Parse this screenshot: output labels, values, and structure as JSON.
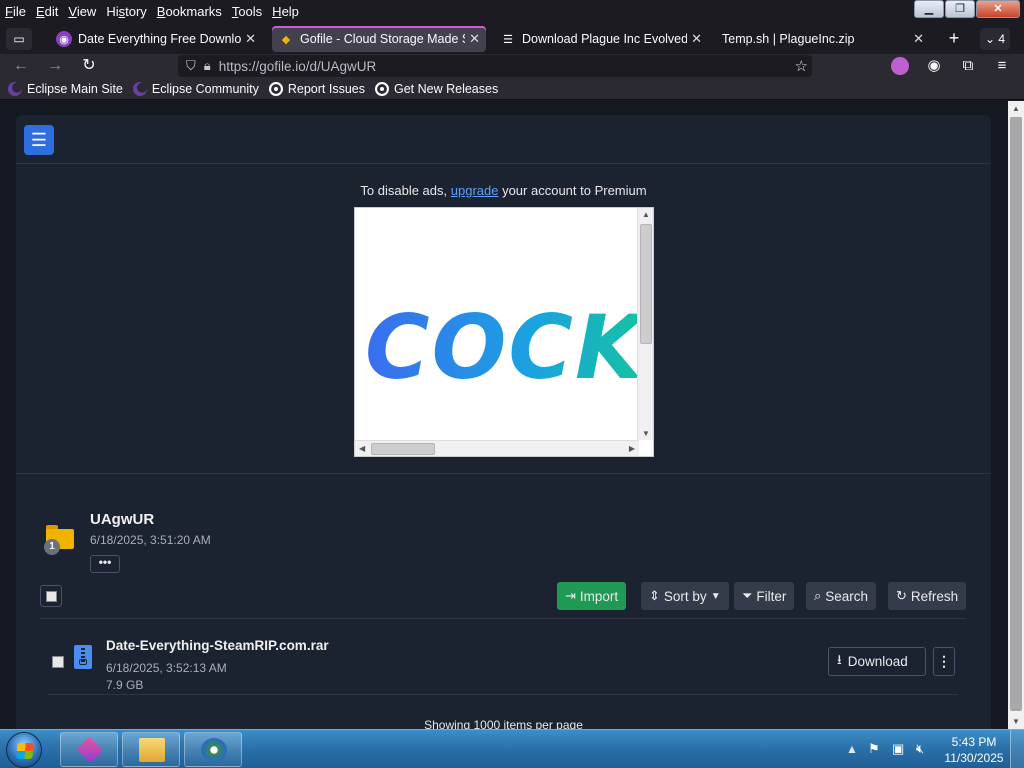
{
  "menubar": {
    "items": [
      {
        "key": "F",
        "rest": "ile"
      },
      {
        "key": "E",
        "rest": "dit"
      },
      {
        "key": "V",
        "rest": "iew"
      },
      {
        "key": "",
        "pre": "Hi",
        "keymid": "s",
        "rest": "tory"
      },
      {
        "key": "B",
        "rest": "ookmarks"
      },
      {
        "key": "T",
        "rest": "ools"
      },
      {
        "key": "H",
        "rest": "elp"
      }
    ]
  },
  "tabs": [
    {
      "title": "Date Everything Free Download",
      "icon": "date-everything-favicon"
    },
    {
      "title": "Gofile - Cloud Storage Made Si",
      "icon": "gofile-favicon",
      "active": true
    },
    {
      "title": "Download Plague Inc Evolved S",
      "icon": "database-favicon"
    },
    {
      "title": "Temp.sh | PlagueInc.zip",
      "icon": "none"
    }
  ],
  "tab_count": "4",
  "navbar": {
    "url": "https://gofile.io/d/UAgwUR"
  },
  "bookmarks": [
    {
      "label": "Eclipse Main Site",
      "icon": "eclipse-icon"
    },
    {
      "label": "Eclipse Community",
      "icon": "eclipse-icon"
    },
    {
      "label": "Report Issues",
      "icon": "github-icon"
    },
    {
      "label": "Get New Releases",
      "icon": "github-icon"
    }
  ],
  "page": {
    "ad_notice_prefix": "To disable ads, ",
    "ad_notice_link": "upgrade",
    "ad_notice_suffix": " your account to Premium",
    "ad_word": "COCK",
    "folder": {
      "name": "UAgwUR",
      "date": "6/18/2025, 3:51:20 AM",
      "badge": "1",
      "more": "•••"
    },
    "toolbar": {
      "import": "Import",
      "sort": "Sort by",
      "filter": "Filter",
      "search": "Search",
      "refresh": "Refresh"
    },
    "files": [
      {
        "name": "Date-Everything-SteamRIP.com.rar",
        "date": "6/18/2025, 3:52:13 AM",
        "size": "7.9 GB",
        "download_label": "Download"
      }
    ],
    "showing_text": "Showing 1000 items per page"
  },
  "taskbar": {
    "time": "5:43 PM",
    "date": "11/30/2025"
  },
  "colors": {
    "accent_blue": "#2f6fdd",
    "import_green": "#1f9a55",
    "link_blue": "#5aa0ff"
  }
}
